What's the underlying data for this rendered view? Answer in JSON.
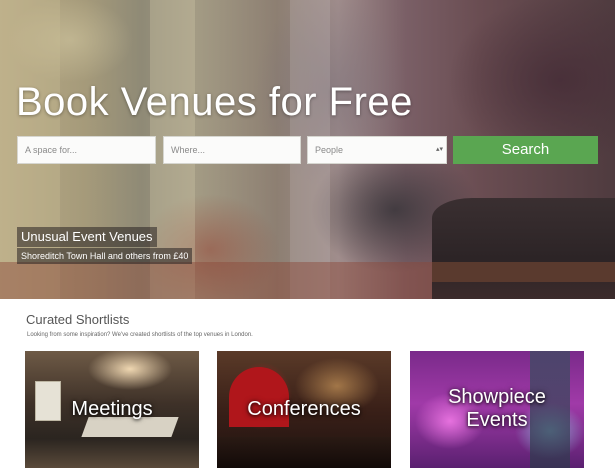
{
  "hero": {
    "title": "Book Venues for Free",
    "search": {
      "space_placeholder": "A space for...",
      "where_placeholder": "Where...",
      "people_value": "People",
      "button_label": "Search"
    },
    "caption": {
      "title": "Unusual Event Venues",
      "subtitle": "Shoreditch Town Hall and others from £40"
    }
  },
  "shortlists": {
    "title": "Curated Shortlists",
    "description": "Looking from some inspiration? We've created shortlists of the top venues in London.",
    "cards": [
      {
        "label": "Meetings"
      },
      {
        "label_line1": "Conferences"
      },
      {
        "label_line1": "Showpiece",
        "label_line2": "Events"
      }
    ]
  },
  "colors": {
    "search_button": "#5aa651",
    "text_white": "#ffffff",
    "section_title": "#555555"
  }
}
